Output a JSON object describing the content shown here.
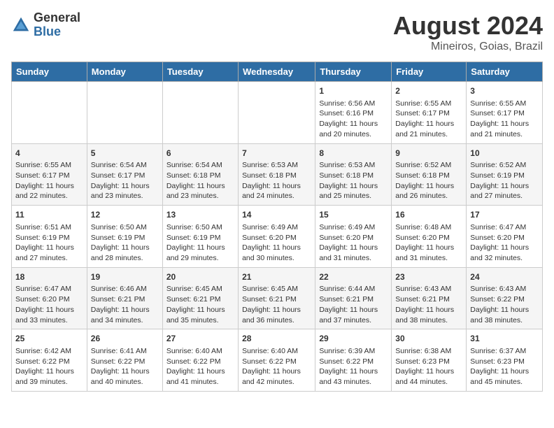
{
  "header": {
    "logo_line1": "General",
    "logo_line2": "Blue",
    "main_title": "August 2024",
    "subtitle": "Mineiros, Goias, Brazil"
  },
  "days_of_week": [
    "Sunday",
    "Monday",
    "Tuesday",
    "Wednesday",
    "Thursday",
    "Friday",
    "Saturday"
  ],
  "weeks": [
    [
      {
        "day": "",
        "info": ""
      },
      {
        "day": "",
        "info": ""
      },
      {
        "day": "",
        "info": ""
      },
      {
        "day": "",
        "info": ""
      },
      {
        "day": "1",
        "info": "Sunrise: 6:56 AM\nSunset: 6:16 PM\nDaylight: 11 hours and 20 minutes."
      },
      {
        "day": "2",
        "info": "Sunrise: 6:55 AM\nSunset: 6:17 PM\nDaylight: 11 hours and 21 minutes."
      },
      {
        "day": "3",
        "info": "Sunrise: 6:55 AM\nSunset: 6:17 PM\nDaylight: 11 hours and 21 minutes."
      }
    ],
    [
      {
        "day": "4",
        "info": "Sunrise: 6:55 AM\nSunset: 6:17 PM\nDaylight: 11 hours and 22 minutes."
      },
      {
        "day": "5",
        "info": "Sunrise: 6:54 AM\nSunset: 6:17 PM\nDaylight: 11 hours and 23 minutes."
      },
      {
        "day": "6",
        "info": "Sunrise: 6:54 AM\nSunset: 6:18 PM\nDaylight: 11 hours and 23 minutes."
      },
      {
        "day": "7",
        "info": "Sunrise: 6:53 AM\nSunset: 6:18 PM\nDaylight: 11 hours and 24 minutes."
      },
      {
        "day": "8",
        "info": "Sunrise: 6:53 AM\nSunset: 6:18 PM\nDaylight: 11 hours and 25 minutes."
      },
      {
        "day": "9",
        "info": "Sunrise: 6:52 AM\nSunset: 6:18 PM\nDaylight: 11 hours and 26 minutes."
      },
      {
        "day": "10",
        "info": "Sunrise: 6:52 AM\nSunset: 6:19 PM\nDaylight: 11 hours and 27 minutes."
      }
    ],
    [
      {
        "day": "11",
        "info": "Sunrise: 6:51 AM\nSunset: 6:19 PM\nDaylight: 11 hours and 27 minutes."
      },
      {
        "day": "12",
        "info": "Sunrise: 6:50 AM\nSunset: 6:19 PM\nDaylight: 11 hours and 28 minutes."
      },
      {
        "day": "13",
        "info": "Sunrise: 6:50 AM\nSunset: 6:19 PM\nDaylight: 11 hours and 29 minutes."
      },
      {
        "day": "14",
        "info": "Sunrise: 6:49 AM\nSunset: 6:20 PM\nDaylight: 11 hours and 30 minutes."
      },
      {
        "day": "15",
        "info": "Sunrise: 6:49 AM\nSunset: 6:20 PM\nDaylight: 11 hours and 31 minutes."
      },
      {
        "day": "16",
        "info": "Sunrise: 6:48 AM\nSunset: 6:20 PM\nDaylight: 11 hours and 31 minutes."
      },
      {
        "day": "17",
        "info": "Sunrise: 6:47 AM\nSunset: 6:20 PM\nDaylight: 11 hours and 32 minutes."
      }
    ],
    [
      {
        "day": "18",
        "info": "Sunrise: 6:47 AM\nSunset: 6:20 PM\nDaylight: 11 hours and 33 minutes."
      },
      {
        "day": "19",
        "info": "Sunrise: 6:46 AM\nSunset: 6:21 PM\nDaylight: 11 hours and 34 minutes."
      },
      {
        "day": "20",
        "info": "Sunrise: 6:45 AM\nSunset: 6:21 PM\nDaylight: 11 hours and 35 minutes."
      },
      {
        "day": "21",
        "info": "Sunrise: 6:45 AM\nSunset: 6:21 PM\nDaylight: 11 hours and 36 minutes."
      },
      {
        "day": "22",
        "info": "Sunrise: 6:44 AM\nSunset: 6:21 PM\nDaylight: 11 hours and 37 minutes."
      },
      {
        "day": "23",
        "info": "Sunrise: 6:43 AM\nSunset: 6:21 PM\nDaylight: 11 hours and 38 minutes."
      },
      {
        "day": "24",
        "info": "Sunrise: 6:43 AM\nSunset: 6:22 PM\nDaylight: 11 hours and 38 minutes."
      }
    ],
    [
      {
        "day": "25",
        "info": "Sunrise: 6:42 AM\nSunset: 6:22 PM\nDaylight: 11 hours and 39 minutes."
      },
      {
        "day": "26",
        "info": "Sunrise: 6:41 AM\nSunset: 6:22 PM\nDaylight: 11 hours and 40 minutes."
      },
      {
        "day": "27",
        "info": "Sunrise: 6:40 AM\nSunset: 6:22 PM\nDaylight: 11 hours and 41 minutes."
      },
      {
        "day": "28",
        "info": "Sunrise: 6:40 AM\nSunset: 6:22 PM\nDaylight: 11 hours and 42 minutes."
      },
      {
        "day": "29",
        "info": "Sunrise: 6:39 AM\nSunset: 6:22 PM\nDaylight: 11 hours and 43 minutes."
      },
      {
        "day": "30",
        "info": "Sunrise: 6:38 AM\nSunset: 6:23 PM\nDaylight: 11 hours and 44 minutes."
      },
      {
        "day": "31",
        "info": "Sunrise: 6:37 AM\nSunset: 6:23 PM\nDaylight: 11 hours and 45 minutes."
      }
    ]
  ]
}
